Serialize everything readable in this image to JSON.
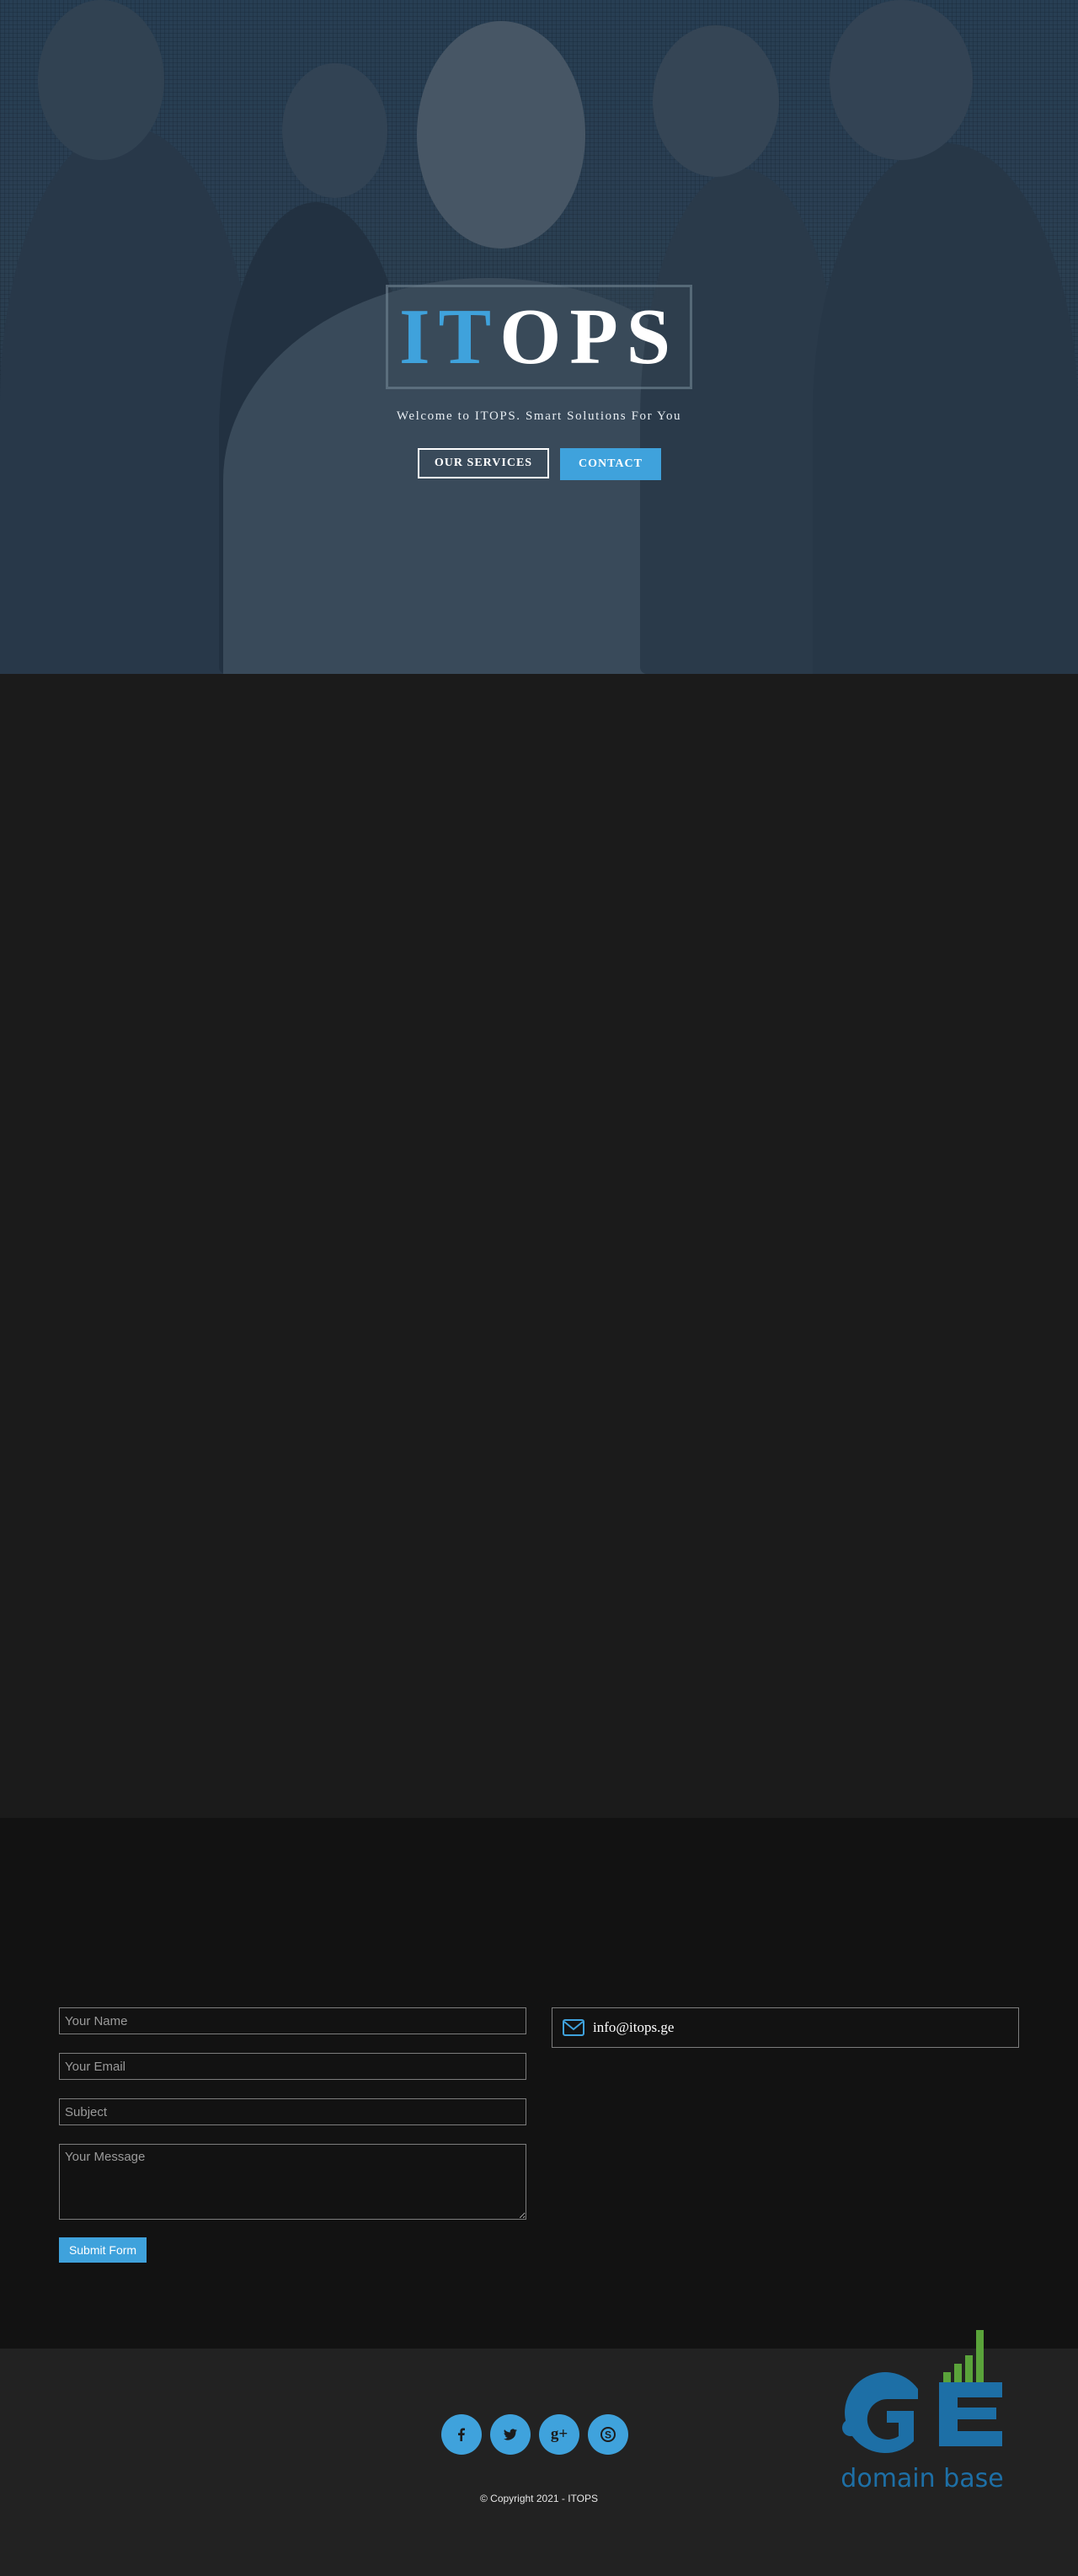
{
  "hero": {
    "logo_accent": "IT",
    "logo_rest": "OPS",
    "tagline": "Welcome to ITOPS. Smart Solutions For You",
    "services_button": "OUR SERVICES",
    "contact_button": "CONTACT"
  },
  "contact": {
    "name_placeholder": "Your Name",
    "email_placeholder": "Your Email",
    "subject_placeholder": "Subject",
    "message_placeholder": "Your Message",
    "submit_label": "Submit Form",
    "email": "info@itops.ge",
    "email_icon": "envelope-icon"
  },
  "footer": {
    "social": [
      {
        "icon": "facebook-icon",
        "glyph": "f"
      },
      {
        "icon": "twitter-icon",
        "glyph": "t"
      },
      {
        "icon": "google-plus-icon",
        "glyph": "g+"
      },
      {
        "icon": "skype-icon",
        "glyph": "S"
      }
    ],
    "copyright": "© Copyright 2021 - ITOPS",
    "badge_text": "domain base",
    "badge_mark": ".GE"
  },
  "colors": {
    "accent": "#3fa2dc",
    "badge_blue": "#1d6fa6",
    "badge_green": "#5aa33a"
  }
}
